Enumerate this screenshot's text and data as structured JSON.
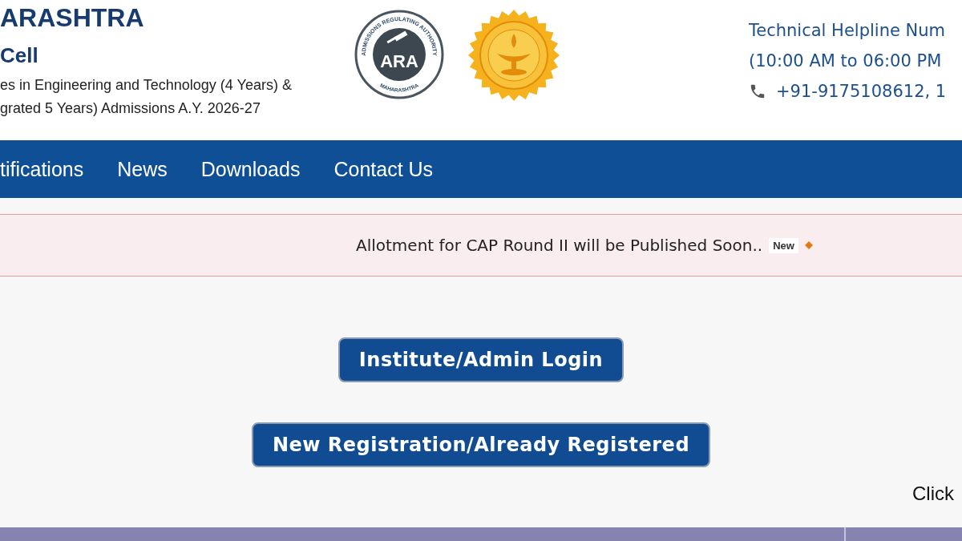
{
  "header": {
    "title": "ARASHTRA",
    "subtitle": "Cell",
    "description_lines": [
      "es in Engineering and Technology (4 Years) &",
      "grated 5 Years) Admissions A.Y. 2026-27"
    ],
    "ara_logo": {
      "ring_top": "ADMISSIONS REGULATING AUTHORITY",
      "letters": "ARA",
      "ring_bottom": "MAHARASHTRA"
    },
    "helpline": {
      "title": "Technical Helpline Num",
      "hours": "(10:00 AM to 06:00 PM",
      "phone": "+91-9175108612, 1"
    }
  },
  "nav": {
    "items": [
      {
        "label": "tifications"
      },
      {
        "label": "News"
      },
      {
        "label": "Downloads"
      },
      {
        "label": "Contact Us"
      }
    ]
  },
  "ticker": {
    "text": "Allotment for CAP Round II will be Published Soon..",
    "badge": "New"
  },
  "buttons": [
    {
      "label": "Institute/Admin Login"
    },
    {
      "label": "New Registration/Already Registered"
    }
  ],
  "footer_note": "Click"
}
